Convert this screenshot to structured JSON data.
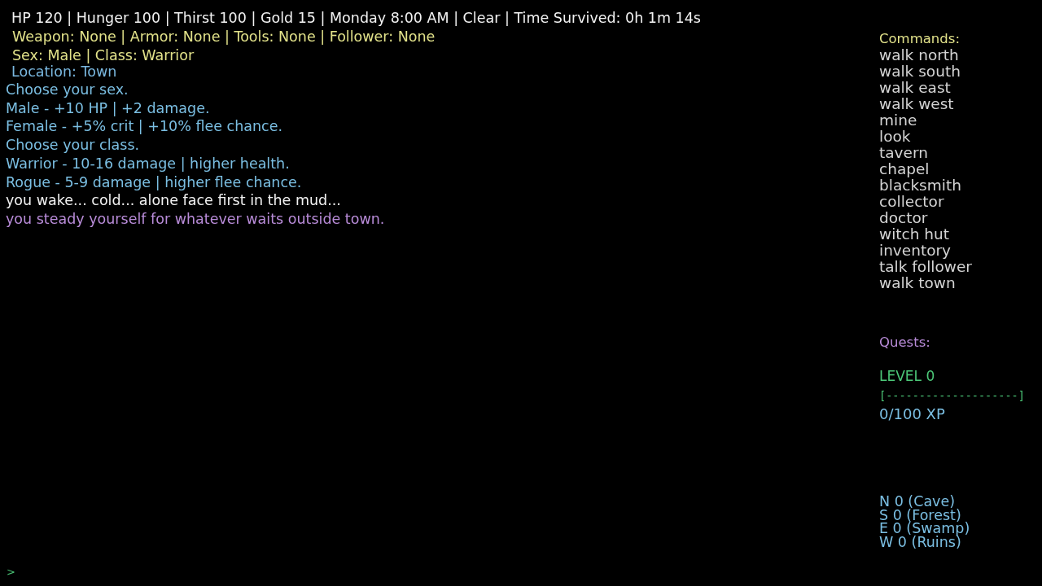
{
  "status_line": "HP 120 | Hunger 100 | Thirst 100 | Gold 15 | Monday 8:00 AM | Clear | Time Survived: 0h 1m 14s",
  "equipment_line": "Weapon: None | Armor: None | Tools: None | Follower: None",
  "character_line": "Sex: Male | Class: Warrior",
  "location_line": "Location: Town",
  "log": [
    {
      "text": "Choose your sex.",
      "color": "#7bbfe3"
    },
    {
      "text": "Male - +10 HP | +2 damage.",
      "color": "#7bbfe3"
    },
    {
      "text": "Female - +5% crit | +10% flee chance.",
      "color": "#7bbfe3"
    },
    {
      "text": "Choose your class.",
      "color": "#7bbfe3"
    },
    {
      "text": "Warrior - 10-16 damage | higher health.",
      "color": "#7bbfe3"
    },
    {
      "text": "Rogue - 5-9 damage | higher flee chance.",
      "color": "#7bbfe3"
    },
    {
      "text": "you wake... cold... alone face first in the mud...",
      "color": "#f2f2f2"
    },
    {
      "text": "you steady yourself for whatever waits outside town.",
      "color": "#b98cd9"
    }
  ],
  "commands": {
    "title": "Commands:",
    "items": [
      "walk north",
      "walk south",
      "walk east",
      "walk west",
      "mine",
      "look",
      "tavern",
      "chapel",
      "blacksmith",
      "collector",
      "doctor",
      "witch hut",
      "inventory",
      "talk follower",
      "walk town"
    ]
  },
  "quests": {
    "title": "Quests:"
  },
  "progress": {
    "label": "LEVEL 0",
    "bar": "[--------------------]",
    "xp": "0/100 XP"
  },
  "directions": [
    "N 0 (Cave)",
    "S 0 (Forest)",
    "E 0 (Swamp)",
    "W 0 (Ruins)"
  ],
  "prompt": ">"
}
